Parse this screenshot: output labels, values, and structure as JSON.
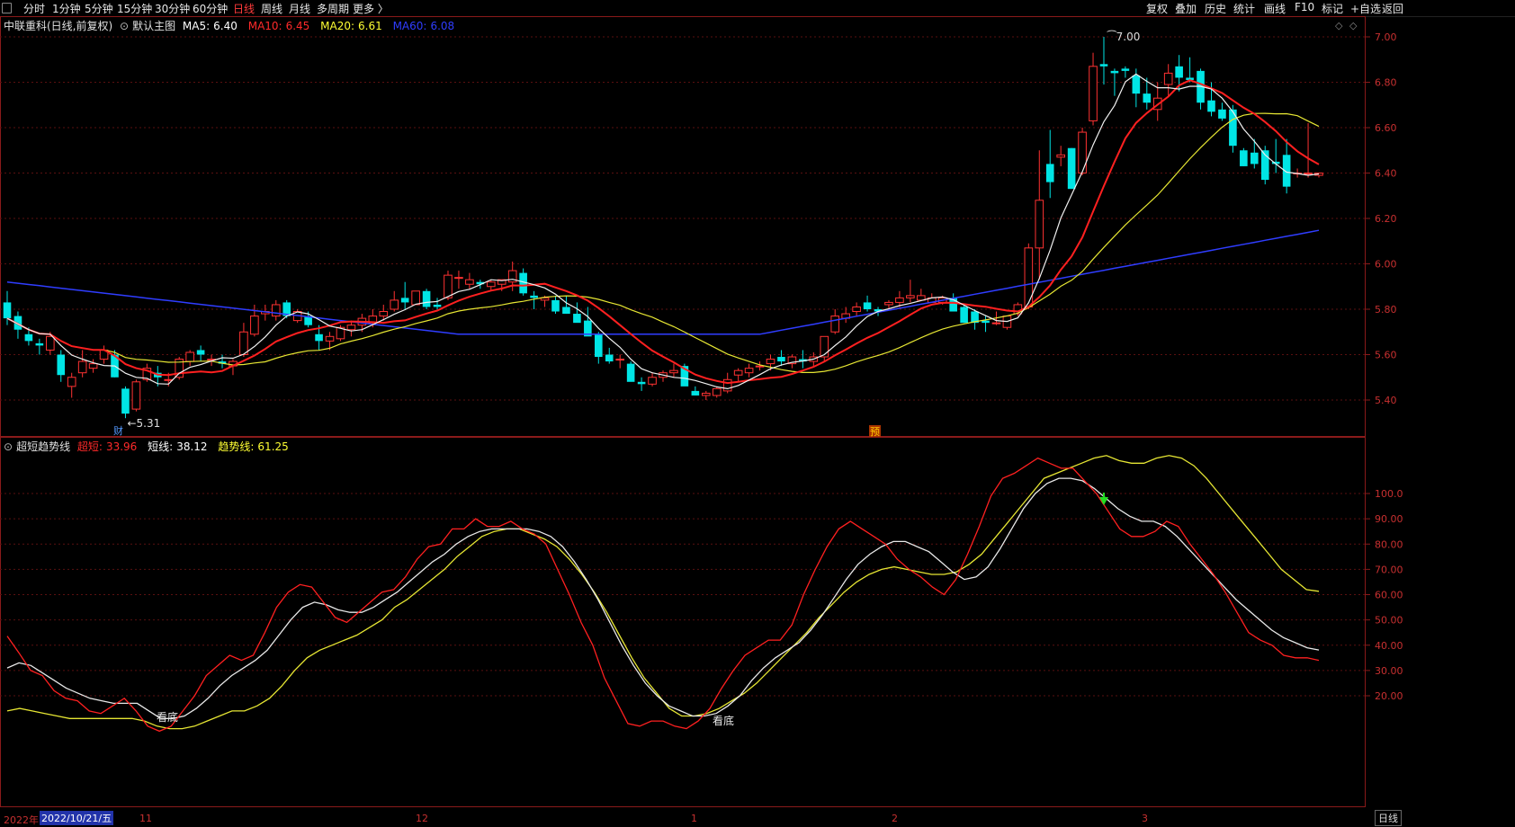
{
  "toolbar": {
    "left": [
      "分时",
      "1分钟",
      "5分钟",
      "15分钟",
      "30分钟",
      "60分钟",
      "日线",
      "周线",
      "月线",
      "多周期",
      "更多 〉"
    ],
    "active": "日线",
    "right": [
      "复权",
      "叠加",
      "历史",
      "统计",
      "画线",
      "F10",
      "标记",
      "+自选",
      "返回"
    ]
  },
  "main_panel": {
    "stock_title": "中联重科(日线,前复权)",
    "template": "默认主图",
    "ma": [
      {
        "label": "MA5:",
        "value": "6.40",
        "color": "#ffffff"
      },
      {
        "label": "MA10:",
        "value": "6.45",
        "color": "#ff2a2a"
      },
      {
        "label": "MA20:",
        "value": "6.61",
        "color": "#ffff33"
      },
      {
        "label": "MA60:",
        "value": "6.08",
        "color": "#2f3dff"
      }
    ],
    "y_ticks": [
      "7.00",
      "6.80",
      "6.60",
      "6.40",
      "6.20",
      "6.00",
      "5.80",
      "5.60",
      "5.40"
    ],
    "max_mark": "7.00",
    "min_mark": "5.31",
    "event_labels": [
      "财",
      "预"
    ]
  },
  "sub_panel": {
    "title": "超短趋势线",
    "items": [
      {
        "label": "超短:",
        "value": "33.96",
        "color": "#ff2a2a"
      },
      {
        "label": "短线:",
        "value": "38.12",
        "color": "#ffffff"
      },
      {
        "label": "趋势线:",
        "value": "61.25",
        "color": "#ffff33"
      }
    ],
    "y_ticks": [
      "100.0",
      "90.00",
      "80.00",
      "70.00",
      "60.00",
      "50.00",
      "40.00",
      "30.00",
      "20.00"
    ],
    "signals": [
      "看底",
      "看底"
    ]
  },
  "x_axis": {
    "year_label": "2022年",
    "cursor_date": "2022/10/21/五",
    "months": [
      "11",
      "12",
      "1",
      "2",
      "3"
    ],
    "period_box": "日线"
  },
  "chart_data": {
    "type": "candlestick",
    "candles": [
      [
        5.83,
        5.88,
        5.73,
        5.76
      ],
      [
        5.77,
        5.79,
        5.67,
        5.71
      ],
      [
        5.69,
        5.72,
        5.64,
        5.66
      ],
      [
        5.65,
        5.67,
        5.6,
        5.64
      ],
      [
        5.62,
        5.7,
        5.6,
        5.68
      ],
      [
        5.6,
        5.62,
        5.48,
        5.51
      ],
      [
        5.46,
        5.52,
        5.41,
        5.5
      ],
      [
        5.52,
        5.62,
        5.5,
        5.57
      ],
      [
        5.54,
        5.58,
        5.52,
        5.56
      ],
      [
        5.58,
        5.64,
        5.56,
        5.62
      ],
      [
        5.6,
        5.62,
        5.5,
        5.5
      ],
      [
        5.45,
        5.46,
        5.32,
        5.34
      ],
      [
        5.36,
        5.49,
        5.35,
        5.48
      ],
      [
        5.49,
        5.56,
        5.48,
        5.54
      ],
      [
        5.52,
        5.55,
        5.46,
        5.5
      ],
      [
        5.49,
        5.52,
        5.46,
        5.49
      ],
      [
        5.5,
        5.59,
        5.49,
        5.58
      ],
      [
        5.57,
        5.62,
        5.55,
        5.61
      ],
      [
        5.62,
        5.64,
        5.57,
        5.6
      ],
      [
        5.58,
        5.6,
        5.55,
        5.58
      ],
      [
        5.57,
        5.6,
        5.54,
        5.56
      ],
      [
        5.55,
        5.58,
        5.51,
        5.57
      ],
      [
        5.6,
        5.74,
        5.59,
        5.7
      ],
      [
        5.69,
        5.82,
        5.68,
        5.77
      ],
      [
        5.78,
        5.82,
        5.75,
        5.79
      ],
      [
        5.77,
        5.84,
        5.75,
        5.82
      ],
      [
        5.83,
        5.84,
        5.76,
        5.77
      ],
      [
        5.75,
        5.8,
        5.74,
        5.79
      ],
      [
        5.77,
        5.79,
        5.72,
        5.73
      ],
      [
        5.69,
        5.73,
        5.62,
        5.66
      ],
      [
        5.66,
        5.7,
        5.62,
        5.68
      ],
      [
        5.67,
        5.73,
        5.66,
        5.72
      ],
      [
        5.71,
        5.75,
        5.68,
        5.73
      ],
      [
        5.73,
        5.78,
        5.7,
        5.76
      ],
      [
        5.74,
        5.8,
        5.72,
        5.77
      ],
      [
        5.77,
        5.82,
        5.75,
        5.79
      ],
      [
        5.8,
        5.88,
        5.79,
        5.84
      ],
      [
        5.85,
        5.92,
        5.8,
        5.83
      ],
      [
        5.82,
        5.88,
        5.82,
        5.88
      ],
      [
        5.88,
        5.89,
        5.8,
        5.81
      ],
      [
        5.82,
        5.85,
        5.8,
        5.81
      ],
      [
        5.85,
        5.97,
        5.84,
        5.95
      ],
      [
        5.94,
        5.97,
        5.89,
        5.94
      ],
      [
        5.91,
        5.96,
        5.89,
        5.93
      ],
      [
        5.92,
        5.93,
        5.89,
        5.91
      ],
      [
        5.9,
        5.93,
        5.88,
        5.92
      ],
      [
        5.91,
        5.93,
        5.88,
        5.93
      ],
      [
        5.92,
        6.01,
        5.88,
        5.97
      ],
      [
        5.96,
        5.98,
        5.86,
        5.87
      ],
      [
        5.86,
        5.88,
        5.8,
        5.85
      ],
      [
        5.84,
        5.86,
        5.81,
        5.85
      ],
      [
        5.84,
        5.86,
        5.78,
        5.79
      ],
      [
        5.81,
        5.86,
        5.78,
        5.78
      ],
      [
        5.78,
        5.83,
        5.75,
        5.74
      ],
      [
        5.75,
        5.81,
        5.69,
        5.68
      ],
      [
        5.69,
        5.7,
        5.56,
        5.59
      ],
      [
        5.6,
        5.63,
        5.56,
        5.57
      ],
      [
        5.58,
        5.6,
        5.54,
        5.58
      ],
      [
        5.56,
        5.57,
        5.49,
        5.48
      ],
      [
        5.48,
        5.5,
        5.44,
        5.47
      ],
      [
        5.47,
        5.52,
        5.46,
        5.5
      ],
      [
        5.5,
        5.53,
        5.48,
        5.52
      ],
      [
        5.52,
        5.56,
        5.5,
        5.53
      ],
      [
        5.55,
        5.56,
        5.48,
        5.46
      ],
      [
        5.44,
        5.46,
        5.42,
        5.42
      ],
      [
        5.42,
        5.44,
        5.4,
        5.43
      ],
      [
        5.42,
        5.46,
        5.41,
        5.45
      ],
      [
        5.44,
        5.52,
        5.43,
        5.49
      ],
      [
        5.51,
        5.54,
        5.48,
        5.53
      ],
      [
        5.52,
        5.56,
        5.5,
        5.54
      ],
      [
        5.55,
        5.57,
        5.53,
        5.55
      ],
      [
        5.56,
        5.6,
        5.53,
        5.58
      ],
      [
        5.59,
        5.62,
        5.55,
        5.57
      ],
      [
        5.56,
        5.6,
        5.54,
        5.59
      ],
      [
        5.58,
        5.62,
        5.54,
        5.57
      ],
      [
        5.57,
        5.61,
        5.55,
        5.59
      ],
      [
        5.59,
        5.68,
        5.57,
        5.68
      ],
      [
        5.7,
        5.8,
        5.69,
        5.77
      ],
      [
        5.76,
        5.81,
        5.74,
        5.78
      ],
      [
        5.79,
        5.83,
        5.77,
        5.81
      ],
      [
        5.83,
        5.86,
        5.79,
        5.8
      ],
      [
        5.8,
        5.81,
        5.77,
        5.79
      ],
      [
        5.82,
        5.84,
        5.8,
        5.83
      ],
      [
        5.83,
        5.88,
        5.81,
        5.85
      ],
      [
        5.85,
        5.93,
        5.83,
        5.86
      ],
      [
        5.84,
        5.89,
        5.84,
        5.86
      ],
      [
        5.83,
        5.87,
        5.83,
        5.85
      ],
      [
        5.83,
        5.86,
        5.82,
        5.85
      ],
      [
        5.85,
        5.87,
        5.81,
        5.79
      ],
      [
        5.81,
        5.82,
        5.74,
        5.74
      ],
      [
        5.79,
        5.8,
        5.71,
        5.74
      ],
      [
        5.75,
        5.77,
        5.7,
        5.74
      ],
      [
        5.74,
        5.79,
        5.73,
        5.74
      ],
      [
        5.72,
        5.77,
        5.71,
        5.77
      ],
      [
        5.78,
        5.83,
        5.77,
        5.82
      ],
      [
        5.81,
        6.09,
        5.8,
        6.07
      ],
      [
        6.07,
        6.5,
        5.93,
        6.28
      ],
      [
        6.44,
        6.59,
        6.29,
        6.36
      ],
      [
        6.47,
        6.52,
        6.43,
        6.48
      ],
      [
        6.51,
        6.51,
        6.35,
        6.33
      ],
      [
        6.4,
        6.6,
        6.39,
        6.58
      ],
      [
        6.63,
        6.93,
        6.61,
        6.87
      ],
      [
        6.88,
        7.0,
        6.79,
        6.87
      ],
      [
        6.85,
        6.86,
        6.74,
        6.84
      ],
      [
        6.86,
        6.87,
        6.82,
        6.85
      ],
      [
        6.83,
        6.86,
        6.69,
        6.75
      ],
      [
        6.75,
        6.82,
        6.68,
        6.71
      ],
      [
        6.68,
        6.8,
        6.63,
        6.73
      ],
      [
        6.79,
        6.88,
        6.74,
        6.84
      ],
      [
        6.87,
        6.92,
        6.76,
        6.82
      ],
      [
        6.82,
        6.91,
        6.8,
        6.81
      ],
      [
        6.85,
        6.86,
        6.68,
        6.71
      ],
      [
        6.72,
        6.8,
        6.65,
        6.67
      ],
      [
        6.68,
        6.71,
        6.63,
        6.64
      ],
      [
        6.68,
        6.7,
        6.49,
        6.52
      ],
      [
        6.5,
        6.51,
        6.43,
        6.43
      ],
      [
        6.49,
        6.55,
        6.42,
        6.44
      ],
      [
        6.5,
        6.52,
        6.35,
        6.37
      ],
      [
        6.45,
        6.55,
        6.4,
        6.44
      ],
      [
        6.48,
        6.55,
        6.31,
        6.34
      ],
      [
        6.4,
        6.42,
        6.38,
        6.4
      ],
      [
        6.4,
        6.62,
        6.38,
        6.4
      ],
      [
        6.39,
        6.4,
        6.38,
        6.4
      ]
    ],
    "ma5_end": 6.4,
    "ma10_end": 6.45,
    "ma20_end": 6.61,
    "ma60_end": 6.08,
    "ylim": [
      5.3,
      7.05
    ],
    "ytick_values": [
      7.0,
      6.8,
      6.6,
      6.4,
      6.2,
      6.0,
      5.8,
      5.6,
      5.4
    ]
  },
  "indicator_data": {
    "type": "line",
    "ylim": [
      4,
      119
    ],
    "ytick_values": [
      100,
      90,
      80,
      70,
      60,
      50,
      40,
      30,
      20
    ],
    "super_short": [
      43.6,
      37,
      30,
      28,
      22,
      19,
      18,
      14,
      13,
      16,
      19,
      14,
      8,
      6,
      8,
      14,
      20,
      28,
      32,
      36,
      34,
      36,
      45,
      55,
      61,
      64,
      63,
      57,
      51,
      49,
      53,
      57,
      61,
      62,
      67,
      74,
      79,
      80,
      86,
      86,
      90,
      87,
      87,
      89,
      86,
      84,
      80,
      70,
      60,
      49,
      40,
      27,
      18,
      9,
      8,
      10,
      10,
      8,
      7,
      10,
      15,
      23,
      30,
      36,
      39,
      42,
      42,
      48,
      60,
      70,
      79,
      86,
      89,
      86,
      83,
      80,
      74,
      70,
      67,
      63,
      60,
      66,
      76,
      87,
      99,
      106,
      108,
      111,
      114,
      112,
      110,
      110,
      105,
      100,
      93,
      86,
      83,
      83,
      85,
      89,
      87,
      80,
      74,
      68,
      61,
      53,
      45,
      42,
      40,
      36,
      35,
      35,
      34
    ],
    "short": [
      31,
      33,
      32,
      29,
      26,
      23,
      21,
      19,
      18,
      17,
      17,
      17,
      14,
      11,
      11,
      12,
      15,
      19,
      24,
      28,
      31,
      34,
      38,
      44,
      50,
      55,
      57,
      56,
      54,
      53,
      53,
      55,
      58,
      61,
      65,
      69,
      73,
      76,
      80,
      83,
      85,
      86,
      86,
      86,
      86,
      85,
      83,
      79,
      73,
      66,
      58,
      49,
      40,
      32,
      25,
      20,
      16,
      14,
      12,
      12,
      13,
      16,
      20,
      26,
      31,
      35,
      38,
      41,
      46,
      52,
      59,
      66,
      72,
      76,
      79,
      81,
      81,
      79,
      77,
      73,
      69,
      66,
      67,
      71,
      78,
      86,
      94,
      100,
      104,
      106,
      106,
      105,
      102,
      98,
      94,
      91,
      89,
      89,
      87,
      83,
      78,
      73,
      68,
      63,
      58,
      54,
      50,
      46,
      43,
      41,
      39,
      38.1
    ],
    "trend": [
      14,
      15,
      14,
      13,
      12,
      11,
      11,
      11,
      11,
      11,
      11,
      10,
      8,
      7,
      7,
      8,
      10,
      12,
      14,
      14,
      16,
      19,
      24,
      30,
      35,
      38,
      40,
      42,
      44,
      47,
      50,
      55,
      58,
      62,
      66,
      70,
      75,
      79,
      83,
      85,
      86,
      86,
      84,
      82,
      79,
      74,
      68,
      61,
      53,
      44,
      35,
      27,
      21,
      15,
      12,
      12,
      13,
      15,
      18,
      21,
      25,
      30,
      35,
      40,
      45,
      51,
      56,
      61,
      65,
      68,
      70,
      71,
      70,
      69,
      68,
      68,
      69,
      72,
      76,
      82,
      88,
      94,
      100,
      106,
      108,
      110,
      112,
      114,
      115,
      113,
      112,
      112,
      114,
      115,
      114,
      111,
      106,
      100,
      94,
      88,
      82,
      76,
      70,
      66,
      62,
      61.3
    ]
  }
}
